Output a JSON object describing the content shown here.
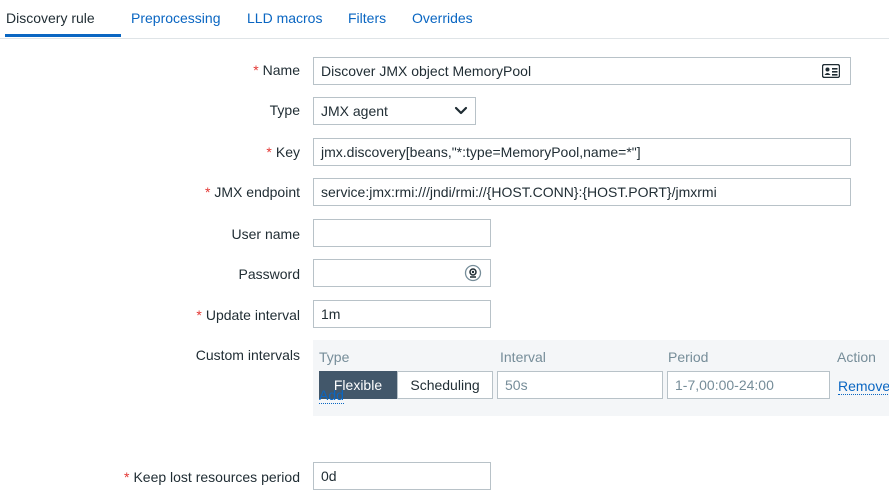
{
  "tabs": [
    "Discovery rule",
    "Preprocessing",
    "LLD macros",
    "Filters",
    "Overrides"
  ],
  "required_mark": "*",
  "form": {
    "name": {
      "label": "Name",
      "value": "Discover JMX object MemoryPool"
    },
    "type": {
      "label": "Type",
      "value": "JMX agent"
    },
    "key": {
      "label": "Key",
      "value": "jmx.discovery[beans,\"*:type=MemoryPool,name=*\"]"
    },
    "jmx_endpoint": {
      "label": "JMX endpoint",
      "value": "service:jmx:rmi:///jndi/rmi://{HOST.CONN}:{HOST.PORT}/jmxrmi"
    },
    "username": {
      "label": "User name",
      "value": ""
    },
    "password": {
      "label": "Password",
      "value": ""
    },
    "update_interval": {
      "label": "Update interval",
      "value": "1m"
    },
    "custom_intervals": {
      "label": "Custom intervals",
      "headers": {
        "type": "Type",
        "interval": "Interval",
        "period": "Period",
        "action": "Action"
      },
      "row": {
        "type_flexible": "Flexible",
        "type_scheduling": "Scheduling",
        "interval_placeholder": "50s",
        "period_placeholder": "1-7,00:00-24:00",
        "remove": "Remove"
      },
      "add": "Add"
    },
    "keep_lost": {
      "label": "Keep lost resources period",
      "value": "0d"
    }
  },
  "colors": {
    "link": "#0a66c2",
    "required": "#e33734",
    "segment_active": "#42576a"
  },
  "icons": {
    "name_field": "address-card-icon",
    "type_select": "chevron-down-icon",
    "password_field": "eye-icon"
  }
}
